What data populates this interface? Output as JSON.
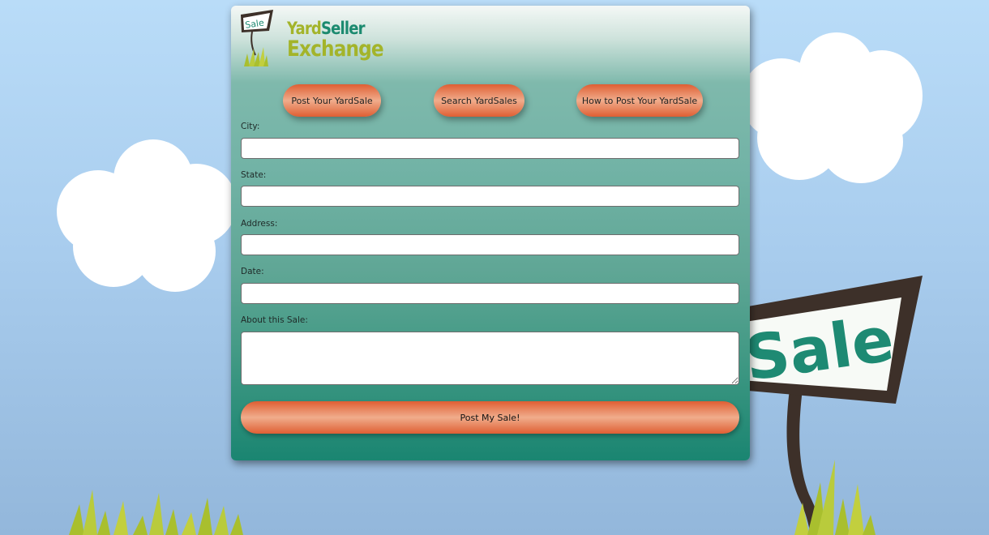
{
  "brand": {
    "sign_text": "Sale",
    "name_part1": "Yard",
    "name_part2": "Seller",
    "name_line2": "Exchange"
  },
  "nav": [
    {
      "label": "Post Your YardSale"
    },
    {
      "label": "Search YardSales"
    },
    {
      "label": "How to Post Your YardSale"
    }
  ],
  "form": {
    "fields": [
      {
        "label": "City:",
        "value": ""
      },
      {
        "label": "State:",
        "value": ""
      },
      {
        "label": "Address:",
        "value": ""
      },
      {
        "label": "Date:",
        "value": ""
      },
      {
        "label": "About this Sale:",
        "value": ""
      }
    ],
    "submit_label": "Post My Sale!"
  },
  "background": {
    "sign_text": "Sale"
  },
  "colors": {
    "sky_top": "#b9dcf8",
    "sky_bottom": "#93b7db",
    "brand_green": "#a3b42a",
    "brand_teal": "#1b8a6f",
    "button_orange": "#df5e33",
    "card_bottom": "#1a8571",
    "sign_wood": "#3d3029"
  }
}
